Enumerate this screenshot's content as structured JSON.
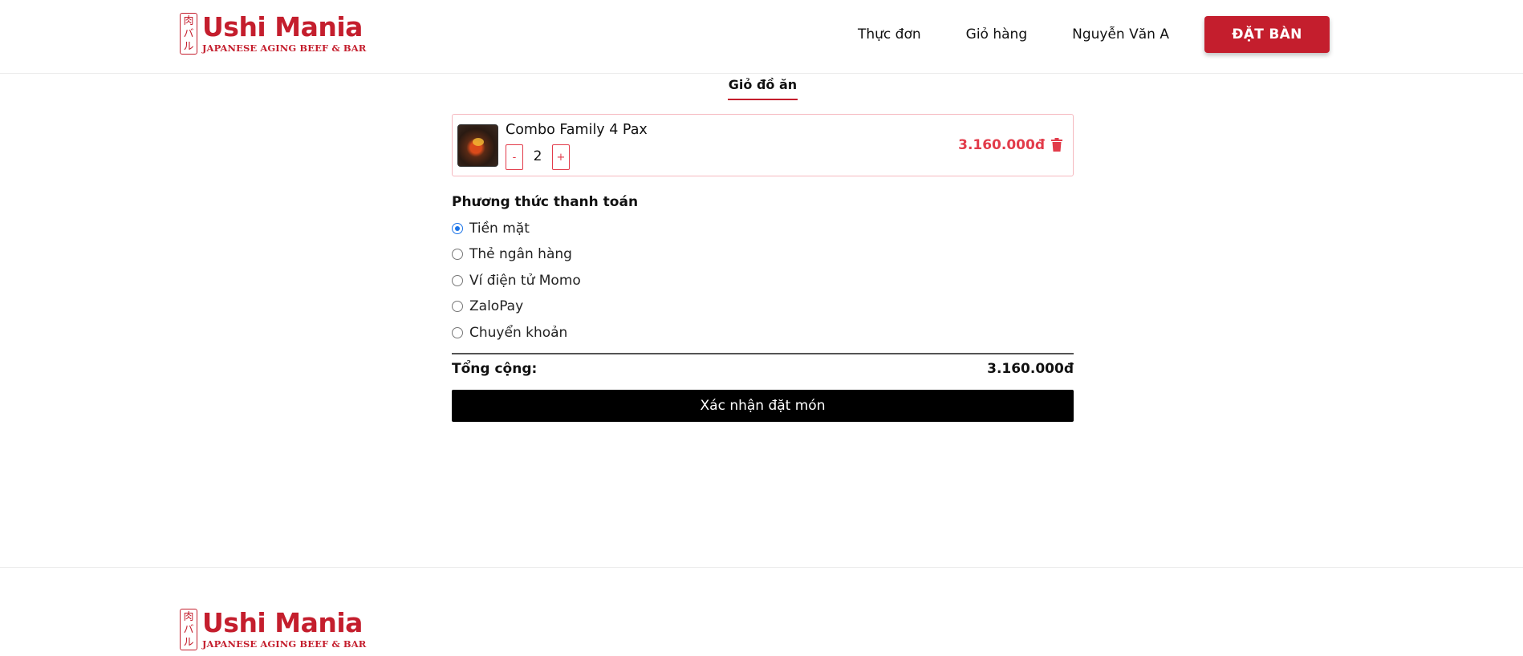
{
  "header": {
    "logo": {
      "kanji": [
        "肉",
        "バ",
        "ル"
      ],
      "brand": "Ushi Mania",
      "tagline": "JAPANESE AGING BEEF & BAR"
    },
    "nav": [
      {
        "label": "Thực đơn"
      },
      {
        "label": "Giỏ hàng"
      },
      {
        "label": "Nguyễn Văn A"
      }
    ],
    "cta_label": "ĐẶT BÀN"
  },
  "main": {
    "section_title": "Giỏ đồ ăn",
    "cart_items": [
      {
        "name": "Combo Family 4 Pax",
        "quantity": "2",
        "minus_label": "-",
        "plus_label": "+",
        "price": "3.160.000đ",
        "delete_icon": "trash-icon"
      }
    ],
    "payment": {
      "title": "Phương thức thanh toán",
      "options": [
        {
          "label": "Tiền mặt",
          "checked": true
        },
        {
          "label": "Thẻ ngân hàng",
          "checked": false
        },
        {
          "label": "Ví điện tử Momo",
          "checked": false
        },
        {
          "label": "ZaloPay",
          "checked": false
        },
        {
          "label": "Chuyển khoản",
          "checked": false
        }
      ]
    },
    "total_label": "Tổng cộng:",
    "total_value": "3.160.000đ",
    "confirm_label": "Xác nhận đặt món"
  },
  "footer": {
    "logo": {
      "kanji": [
        "肉",
        "バ",
        "ル"
      ],
      "brand": "Ushi Mania",
      "tagline": "JAPANESE AGING BEEF & BAR"
    }
  },
  "colors": {
    "brand_red": "#c41e2d",
    "price_red": "#e23b4a",
    "radio_blue": "#1a73e8",
    "button_black": "#000000"
  }
}
